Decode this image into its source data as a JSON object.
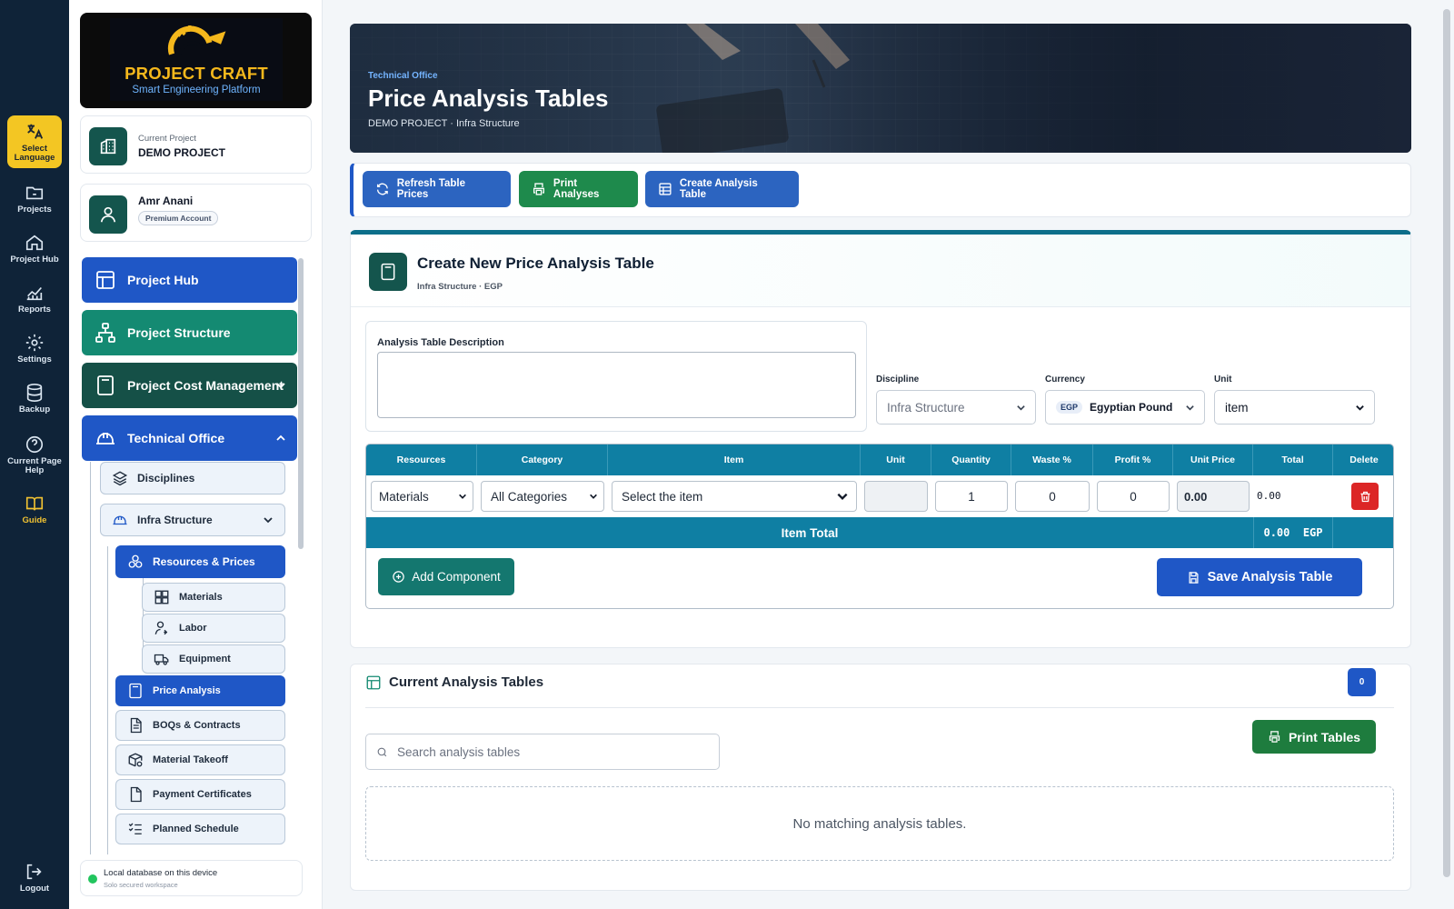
{
  "rail": {
    "items": [
      {
        "label": "Select Language",
        "icon": "translate-icon"
      },
      {
        "label": "Projects",
        "icon": "folder-icon"
      },
      {
        "label": "Project Hub",
        "icon": "home-icon"
      },
      {
        "label": "Reports",
        "icon": "chart-icon"
      },
      {
        "label": "Settings",
        "icon": "gear-icon"
      },
      {
        "label": "Backup",
        "icon": "database-icon"
      },
      {
        "label": "Current Page Help",
        "icon": "help-icon"
      },
      {
        "label": "Guide",
        "icon": "book-icon"
      },
      {
        "label": "Logout",
        "icon": "logout-icon"
      }
    ]
  },
  "brand": {
    "title": "PROJECT CRAFT",
    "subtitle": "Smart Engineering Platform"
  },
  "project_card": {
    "label": "Current Project",
    "name": "DEMO PROJECT"
  },
  "user_card": {
    "name": "Amr Anani",
    "badge": "Premium Account"
  },
  "nav": {
    "project_hub": "Project Hub",
    "project_structure": "Project Structure",
    "project_cost": "Project Cost Management",
    "technical_office": "Technical Office",
    "disciplines": "Disciplines",
    "infra": "Infra Structure",
    "resources": "Resources & Prices",
    "materials": "Materials",
    "labor": "Labor",
    "equipment": "Equipment",
    "price_analysis": "Price Analysis",
    "boqs": "BOQs & Contracts",
    "takeoff": "Material Takeoff",
    "payment": "Payment Certificates",
    "schedule": "Planned Schedule"
  },
  "status": {
    "title": "Local database on this device",
    "subtitle": "Solo secured workspace"
  },
  "hero": {
    "kicker": "Technical Office",
    "title": "Price Analysis Tables",
    "subtitle": "DEMO PROJECT · Infra Structure"
  },
  "toolbar": {
    "refresh": "Refresh Table Prices",
    "print": "Print Analyses",
    "create": "Create Analysis Table"
  },
  "form": {
    "title": "Create New Price Analysis Table",
    "subtitle": "Infra Structure · EGP",
    "desc_label": "Analysis Table Description",
    "desc_value": "",
    "discipline_label": "Discipline",
    "discipline_value": "Infra Structure",
    "currency_label": "Currency",
    "currency_code": "EGP",
    "currency_value": "Egyptian Pound",
    "unit_label": "Unit",
    "unit_value": "item"
  },
  "table": {
    "headers": [
      "Resources",
      "Category",
      "Item",
      "Unit",
      "Quantity",
      "Waste %",
      "Profit %",
      "Unit Price",
      "Total",
      "Delete"
    ],
    "row": {
      "resource": "Materials",
      "category": "All Categories",
      "item": "Select the item",
      "unit": "",
      "quantity": "1",
      "waste": "0",
      "profit": "0",
      "unit_price": "0.00",
      "total": "0.00"
    },
    "item_total_label": "Item Total",
    "item_total_value": "0.00  EGP"
  },
  "actions": {
    "add": "Add Component",
    "save": "Save Analysis Table"
  },
  "current": {
    "title": "Current Analysis Tables",
    "count": "0",
    "search_placeholder": "Search analysis tables",
    "print": "Print Tables",
    "empty": "No matching analysis tables."
  },
  "colors": {
    "primary": "#1f57c6",
    "teal": "#0f7fa3",
    "green": "#1e8a4c",
    "dark_teal": "#14554d",
    "rail": "#0f2338"
  }
}
